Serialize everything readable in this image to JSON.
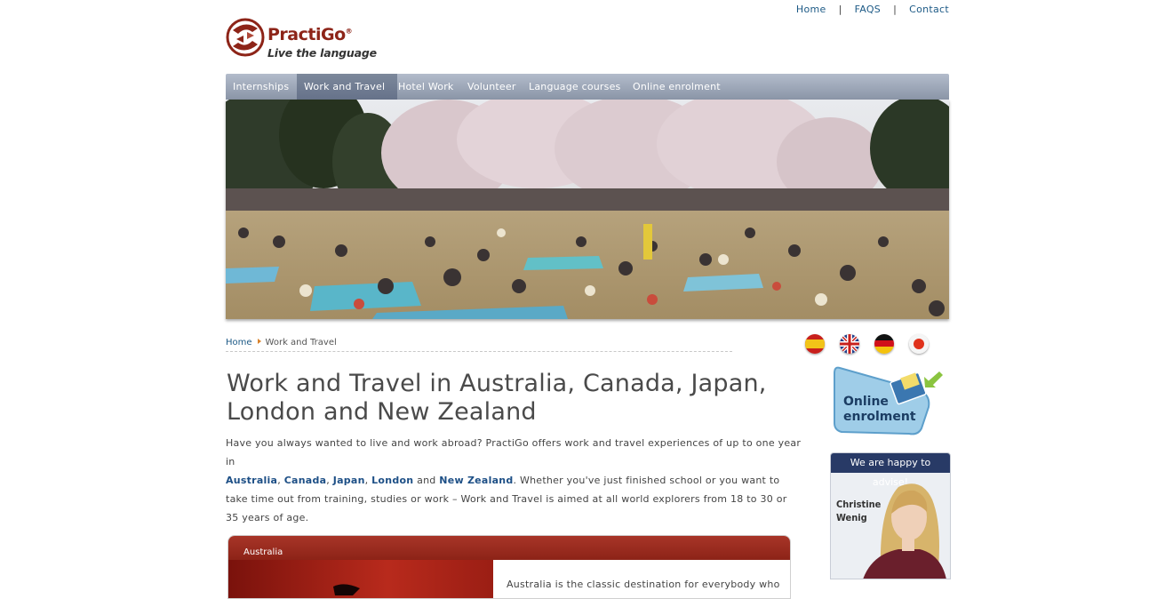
{
  "top_links": [
    "Home",
    "FAQS",
    "Contact"
  ],
  "logo": {
    "brand": "PractiGo",
    "registered": "®",
    "tagline": "Live the language"
  },
  "nav": [
    "Internships",
    "Work and Travel",
    "Hotel Work",
    "Volunteer",
    "Language courses",
    "Online enrolment"
  ],
  "nav_active": "Work and Travel",
  "breadcrumb": {
    "home": "Home",
    "current": "Work and Travel"
  },
  "languages": [
    "spanish-flag",
    "uk-flag",
    "german-flag",
    "japanese-flag"
  ],
  "heading": "Work and Travel in Australia, Canada, Japan, London and New Zealand",
  "intro": {
    "p1": "Have you always wanted to live and work abroad? PractiGo offers work and travel experiences of up to one year in",
    "australia": "Australia",
    "comma1": ", ",
    "canada": "Canada",
    "comma2": ", ",
    "japan": "Japan",
    "comma3": ", ",
    "london": "London",
    "and": " and ",
    "newzealand": "New Zealand",
    "p2": ". Whether you've just finished school or you want to take time out from training, studies or work – Work and Travel is aimed at all world explorers from 18 to 30 or 35 years of age."
  },
  "enrolment": {
    "line1": "Online",
    "line2": "enrolment"
  },
  "advisor": {
    "header": "We are happy to advise!",
    "first": "Christine",
    "last": "Wenig"
  },
  "card": {
    "title": "Australia",
    "text": "Australia is the classic destination for everybody who"
  },
  "colors": {
    "brand_red": "#8d2418",
    "nav_blue": "#8a95a7",
    "link_blue": "#1d5a86",
    "advisor_navy": "#283a66"
  }
}
